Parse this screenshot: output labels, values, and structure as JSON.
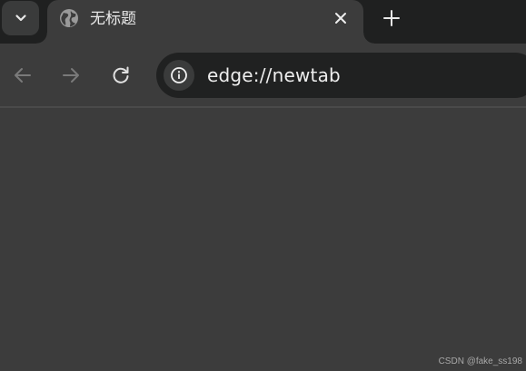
{
  "tabstrip": {
    "tab_search_icon": "chevron-down-icon",
    "tab": {
      "title": "无标题",
      "favicon": "globe-icon",
      "close_icon": "close-icon"
    },
    "new_tab_icon": "plus-icon"
  },
  "toolbar": {
    "back_icon": "arrow-left-icon",
    "forward_icon": "arrow-right-icon",
    "refresh_icon": "refresh-icon",
    "site_info_icon": "info-icon",
    "url": "edge://newtab"
  },
  "watermark": "CSDN @fake_ss198",
  "colors": {
    "tabstrip_bg": "#1f2020",
    "active_tab_bg": "#3c3c3c",
    "omnibox_bg": "#202121",
    "text": "#e8e8e8",
    "disabled_icon": "#7a7a7a"
  }
}
